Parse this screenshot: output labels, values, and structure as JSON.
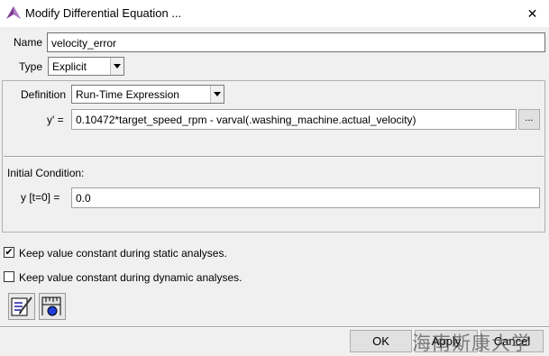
{
  "window": {
    "title": "Modify Differential Equation ...",
    "close_glyph": "✕"
  },
  "name": {
    "label": "Name",
    "value": "velocity_error"
  },
  "type": {
    "label": "Type",
    "value": "Explicit"
  },
  "definition": {
    "label": "Definition",
    "value": "Run-Time Expression",
    "yprime_label": "y' =",
    "expression": "0.10472*target_speed_rpm - varval(.washing_machine.actual_velocity)",
    "ellipsis_label": "..."
  },
  "initial_condition": {
    "heading": "Initial Condition:",
    "label": "y [t=0] =",
    "value": "0.0"
  },
  "options": {
    "static_label": "Keep value constant during static analyses.",
    "static_checked": true,
    "dynamic_label": "Keep value constant during dynamic analyses.",
    "dynamic_checked": false,
    "check_glyph": "✔"
  },
  "toolbar": {
    "icon1": "edit-notes-icon",
    "icon2": "measure-plot-icon"
  },
  "buttons": {
    "ok": "OK",
    "apply": "Apply",
    "cancel": "Cancel"
  },
  "watermark": "海南斯康大学",
  "colors": {
    "titlebar": "#ffffff",
    "dialog_bg": "#f0f0f0",
    "field_bg": "#ffffff",
    "app_icon": "#7a3d8f"
  }
}
